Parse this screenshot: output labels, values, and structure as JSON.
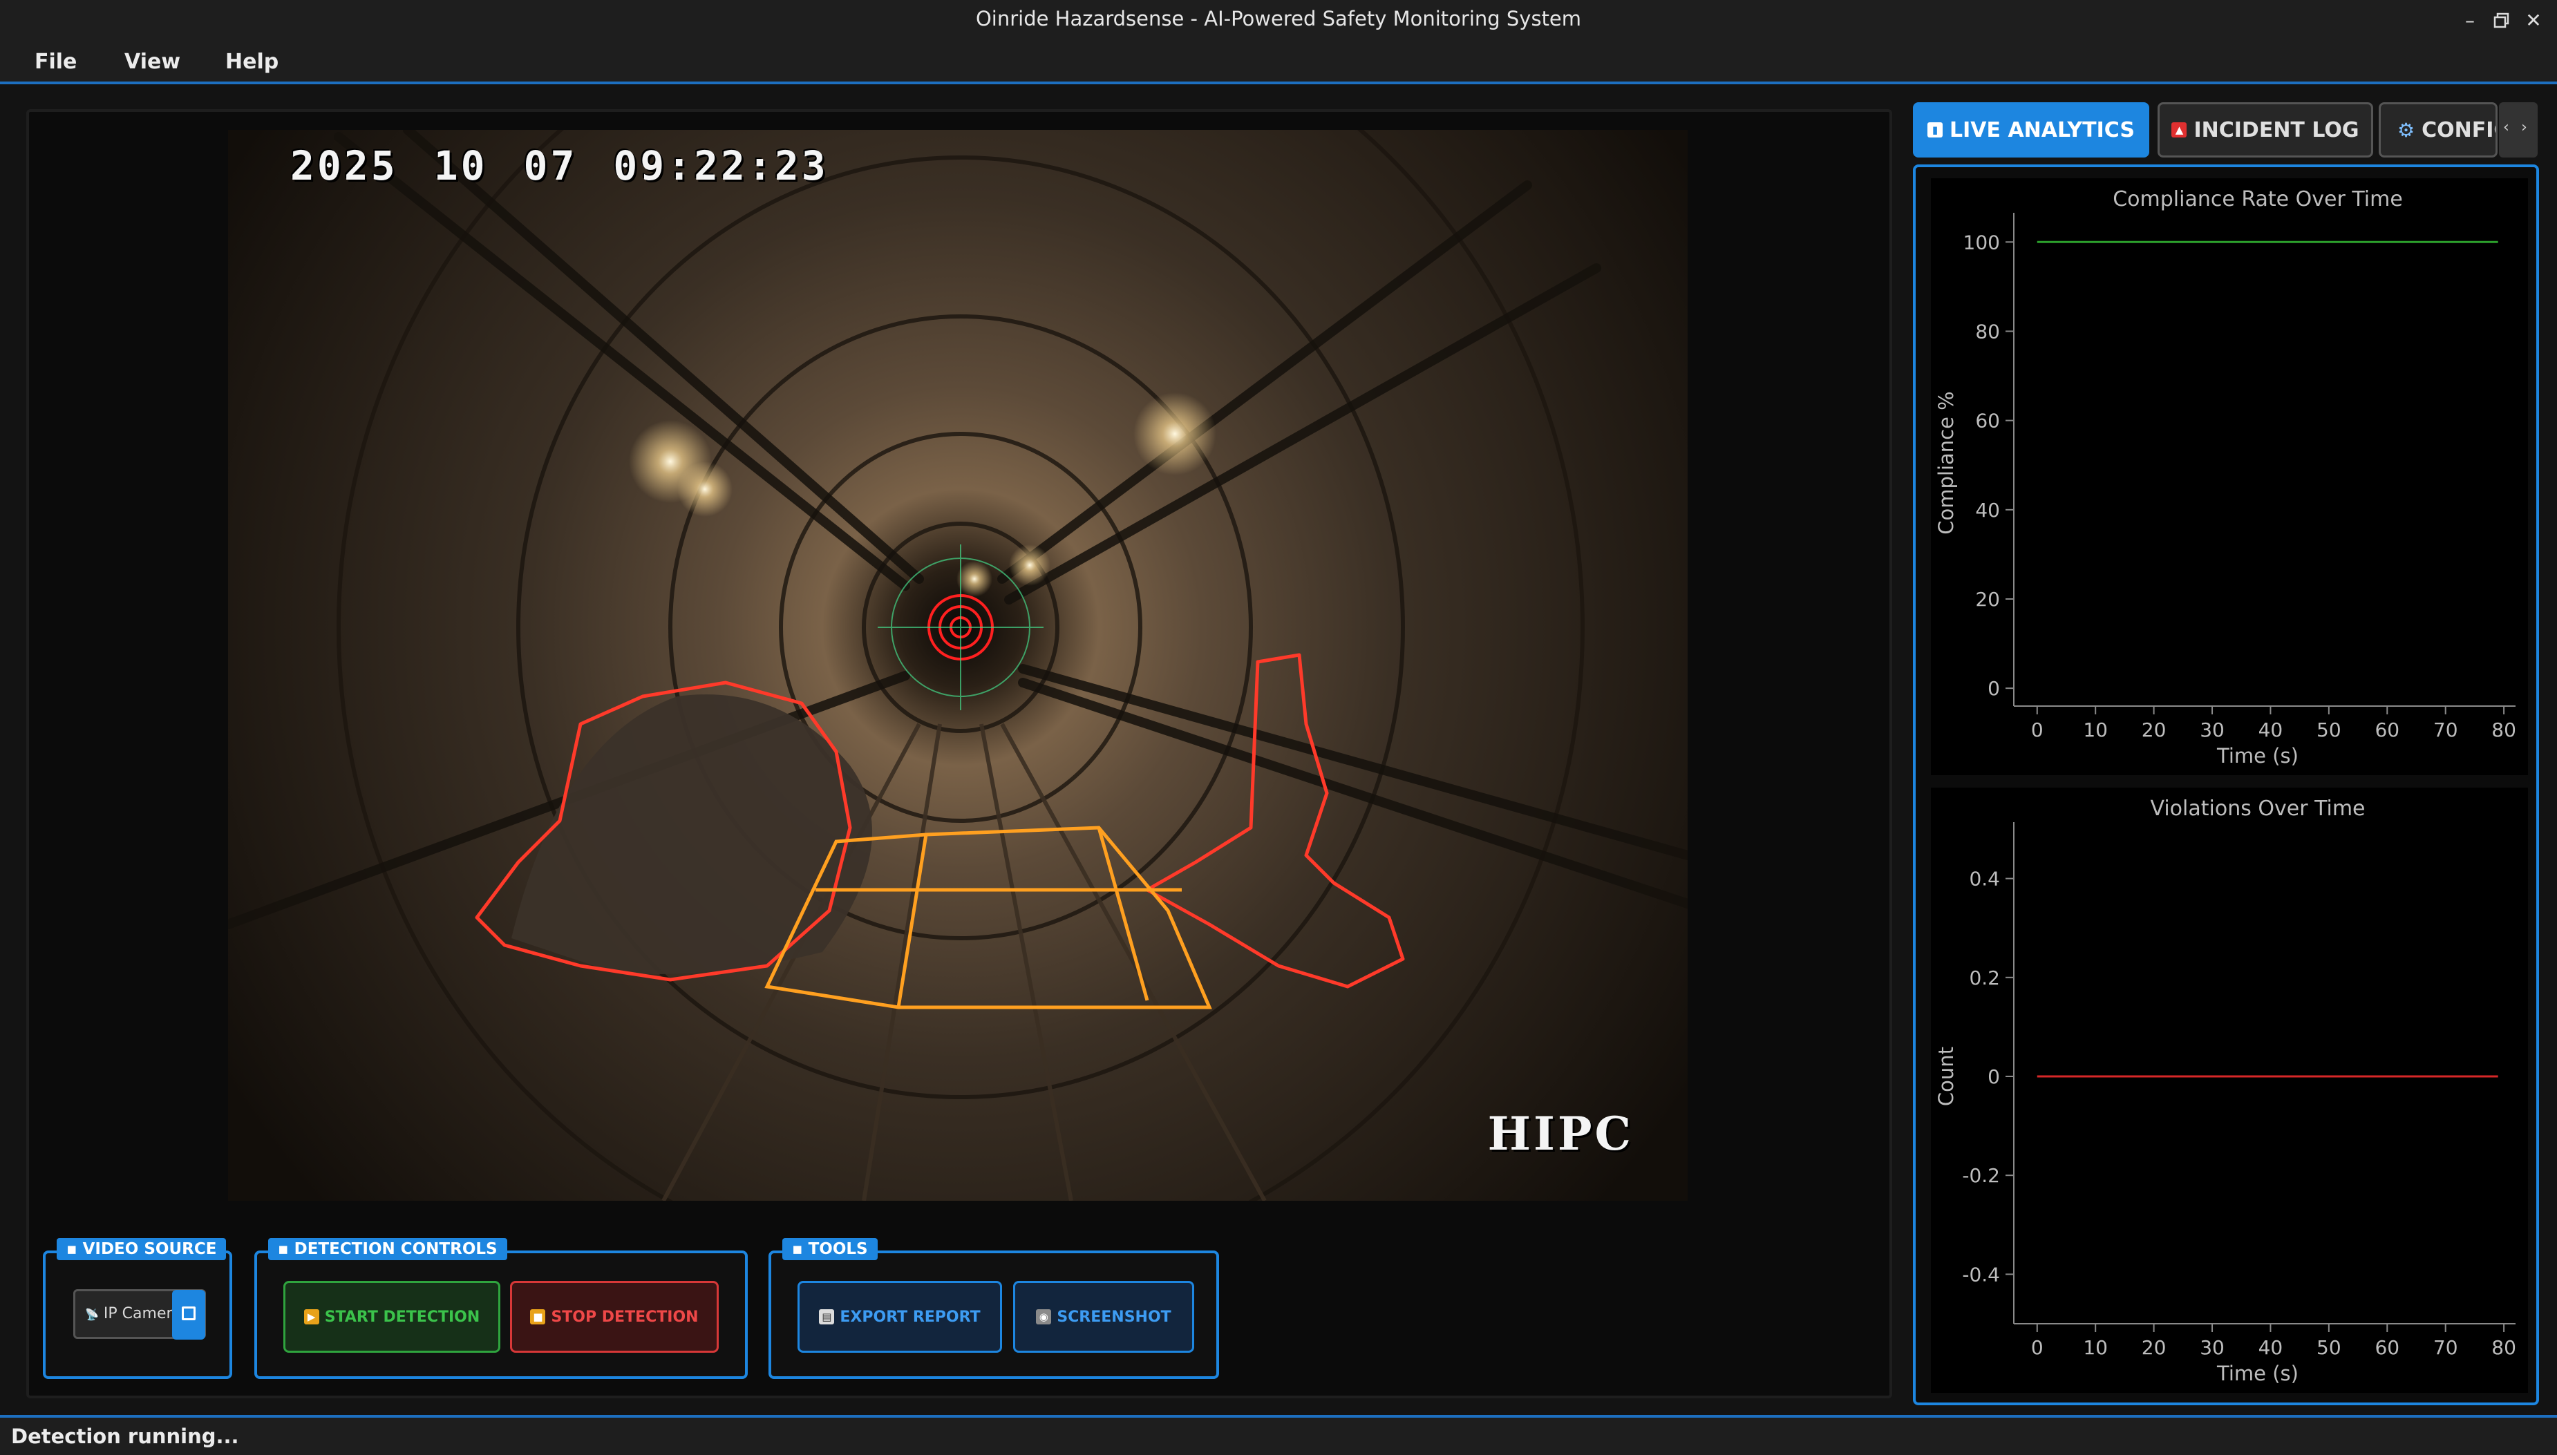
{
  "window": {
    "title": "Oinride Hazardsense - AI-Powered Safety Monitoring System"
  },
  "menu": {
    "file": "File",
    "view": "View",
    "help": "Help"
  },
  "video": {
    "timestamp": {
      "year": "2025",
      "month": "10",
      "day": "07",
      "time": "09:22:23"
    },
    "watermark": "HIPC"
  },
  "groups": {
    "video_source": {
      "title": "VIDEO SOURCE",
      "combo_value": "IP Camer",
      "title_icon": "camera-icon",
      "combo_icon": "antenna-icon"
    },
    "detection_controls": {
      "title": "DETECTION CONTROLS",
      "start_label": "START DETECTION",
      "stop_label": "STOP DETECTION",
      "title_icon": "gamepad-icon"
    },
    "tools": {
      "title": "TOOLS",
      "export_label": "EXPORT REPORT",
      "screenshot_label": "SCREENSHOT",
      "title_icon": "wrench-icon"
    }
  },
  "tabs": [
    {
      "label": "LIVE ANALYTICS",
      "icon": "bar-chart-icon",
      "active": true
    },
    {
      "label": "INCIDENT LOG",
      "icon": "siren-icon",
      "active": false
    },
    {
      "label": "CONFIG",
      "icon": "gear-icon",
      "active": false
    }
  ],
  "status": {
    "text": "Detection running..."
  },
  "colors": {
    "accent": "#1d86e0",
    "compliance_line": "#2ca02c",
    "violations_line": "#d62728",
    "start": "#2fa43e",
    "stop": "#d73838"
  },
  "chart_data": [
    {
      "type": "line",
      "title": "Compliance Rate Over Time",
      "xlabel": "Time (s)",
      "ylabel": "Compliance %",
      "xlim": [
        -4,
        82
      ],
      "ylim": [
        -4,
        105
      ],
      "xticks": [
        0,
        10,
        20,
        30,
        40,
        50,
        60,
        70,
        80
      ],
      "yticks": [
        0,
        20,
        40,
        60,
        80,
        100
      ],
      "series": [
        {
          "x": [
            0,
            79
          ],
          "y": [
            100,
            100
          ],
          "color": "#2ca02c"
        }
      ]
    },
    {
      "type": "line",
      "title": "Violations Over Time",
      "xlabel": "Time (s)",
      "ylabel": "Count",
      "xlim": [
        -4,
        82
      ],
      "ylim": [
        -0.5,
        0.5
      ],
      "xticks": [
        0,
        10,
        20,
        30,
        40,
        50,
        60,
        70,
        80
      ],
      "yticks": [
        -0.4,
        -0.2,
        0,
        0.2,
        0.4
      ],
      "series": [
        {
          "x": [
            0,
            79
          ],
          "y": [
            0,
            0
          ],
          "color": "#d62728"
        }
      ]
    }
  ]
}
